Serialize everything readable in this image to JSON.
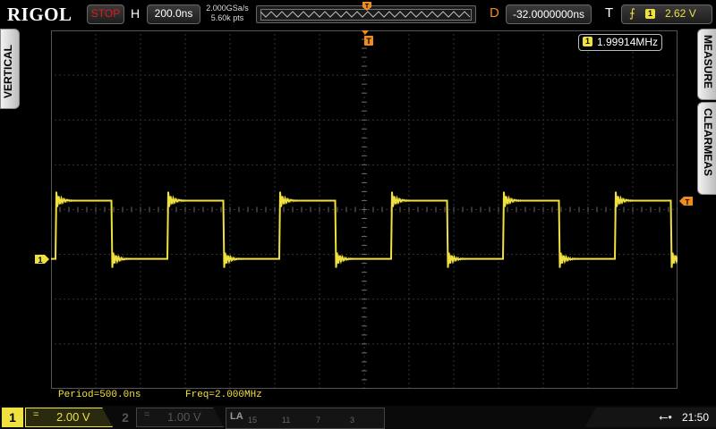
{
  "brand": "RIGOL",
  "header": {
    "run_state": "STOP",
    "horizontal_label": "H",
    "timebase": "200.0ns",
    "sample_rate": "2.000GSa/s",
    "memory_depth": "5.60k pts",
    "delay_label": "D",
    "delay": "-32.0000000ns",
    "trigger_label": "T",
    "trigger_source": "1",
    "trigger_level": "2.62 V"
  },
  "side_tabs": {
    "left": "VERTICAL",
    "right_top": "MEASURE",
    "right_bottom": "CLEARMEAS"
  },
  "freq_counter": {
    "source": "1",
    "value": "1.99914MHz"
  },
  "measurements": [
    {
      "text": "Period=500.0ns"
    },
    {
      "text": "Freq=2.000MHz"
    }
  ],
  "channels": {
    "ch1": {
      "number": "1",
      "coupling": "=",
      "scale": "2.00 V",
      "active": true
    },
    "ch2": {
      "number": "2",
      "coupling": "=",
      "scale": "1.00 V",
      "active": false
    }
  },
  "la": {
    "label": "LA",
    "groups": [
      "15",
      "11",
      "7",
      "3"
    ]
  },
  "status": {
    "clock": "21:50",
    "usb_icon": "usb-icon"
  },
  "colors": {
    "ch1": "#f0e040",
    "stop": "#e01b1b",
    "trigger": "#f08c1e",
    "grid": "#6a6a6a"
  },
  "waveform": {
    "channel": "1",
    "period_ns": 500,
    "high_level_div": 1.25,
    "low_level_div": -0.05,
    "first_falling_edge_ns": -630,
    "duty_cycle": 0.5
  }
}
